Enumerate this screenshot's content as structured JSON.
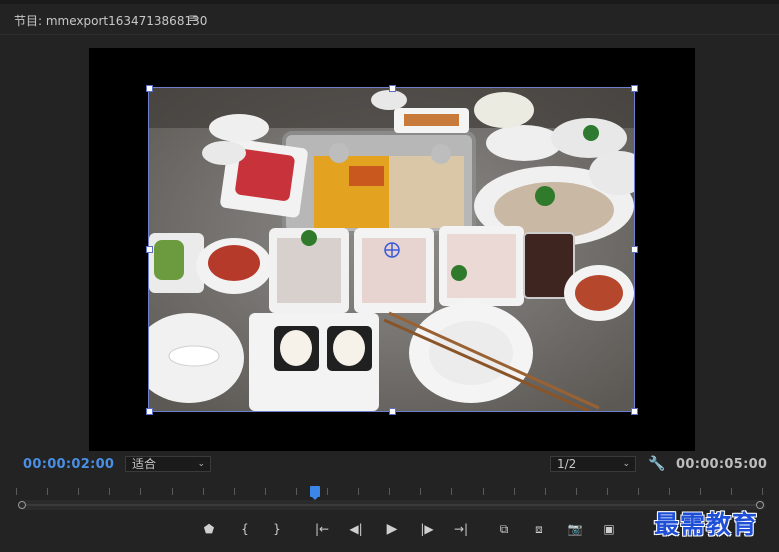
{
  "panel": {
    "title": "节目: mmexport1634713868130",
    "menu_icon": "≡"
  },
  "controls": {
    "current_timecode": "00:00:02:00",
    "zoom_select": "适合",
    "resolution_select": "1/2",
    "duration_timecode": "00:00:05:00"
  },
  "transport": {
    "icons": [
      "marker-icon",
      "mark-in-icon",
      "mark-out-icon",
      "go-to-in-icon",
      "step-back-icon",
      "play-icon",
      "step-forward-icon",
      "go-to-out-icon",
      "insert-icon",
      "overwrite-icon",
      "export-frame-icon",
      "comparison-view-icon"
    ]
  },
  "timeline": {
    "playhead_position_fraction": 0.4
  },
  "watermark": "最需教育",
  "colors": {
    "accent": "#4a8fe6",
    "playhead": "#3b86e6",
    "watermark": "#1e4fd6"
  }
}
